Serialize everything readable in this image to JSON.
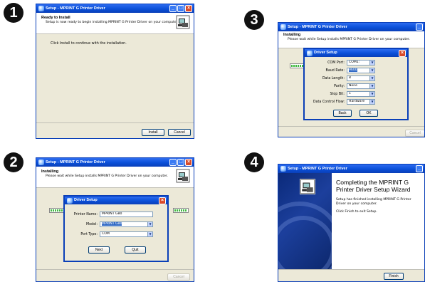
{
  "steps": {
    "step1": {
      "number": "1",
      "title": "Setup - MPRINT G Printer Driver",
      "header_title": "Ready to Install",
      "header_sub": "Setup is now ready to begin installing MPRINT G Printer Driver on your computer.",
      "body": "Click Install to continue with the installation.",
      "install_label": "Install",
      "cancel_label": "Cancel"
    },
    "step2": {
      "number": "2",
      "title": "Setup - MPRINT G Printer Driver",
      "header_title": "Installing",
      "header_sub": "Please wait while Setup installs MPRINT G Printer Driver on your computer.",
      "cancel_label": "Cancel",
      "dialog": {
        "title": "Driver Setup",
        "printer_name_label": "Printer Name:",
        "printer_name_value": "MPRINT G80",
        "model_label": "Model:",
        "model_value": "MPRINT G80",
        "port_type_label": "Port Type:",
        "port_type_value": "COM",
        "next_label": "Next",
        "quit_label": "Quit"
      }
    },
    "step3": {
      "number": "3",
      "title": "Setup - MPRINT G Printer Driver",
      "header_title": "Installing",
      "header_sub": "Please wait while Setup installs MPRINT G Printer Driver on your computer.",
      "cancel_label": "Cancel",
      "dialog": {
        "title": "Driver Setup",
        "fields": [
          {
            "label": "COM Port:",
            "value": "COM1:",
            "highlight": false
          },
          {
            "label": "Baud Rate:",
            "value": "9600",
            "highlight": true
          },
          {
            "label": "Data Length:",
            "value": "8",
            "highlight": false
          },
          {
            "label": "Parity:",
            "value": "None",
            "highlight": false
          },
          {
            "label": "Stop Bit:",
            "value": "1",
            "highlight": false
          },
          {
            "label": "Data Control Flow:",
            "value": "Hardware",
            "highlight": false
          }
        ],
        "back_label": "Back",
        "ok_label": "OK"
      }
    },
    "step4": {
      "number": "4",
      "title": "Setup - MPRINT G Printer Driver",
      "wizard_title": "Completing the MPRINT G Printer Driver Setup Wizard",
      "para1": "Setup has finished installing MPRINT G Printer Driver on your computer.",
      "para2": "Click Finish to exit Setup.",
      "finish_label": "Finish"
    }
  },
  "icons": {
    "window": "setup-icon",
    "computer": "computer-box-icon",
    "dialog": "driver-setup-icon"
  },
  "colors": {
    "titlebar": "#0a4fd8",
    "window_bg": "#ece9d8",
    "close_btn": "#d84a2a",
    "progress": "#3fb93f",
    "wizard_side": "#1c3f9c"
  }
}
